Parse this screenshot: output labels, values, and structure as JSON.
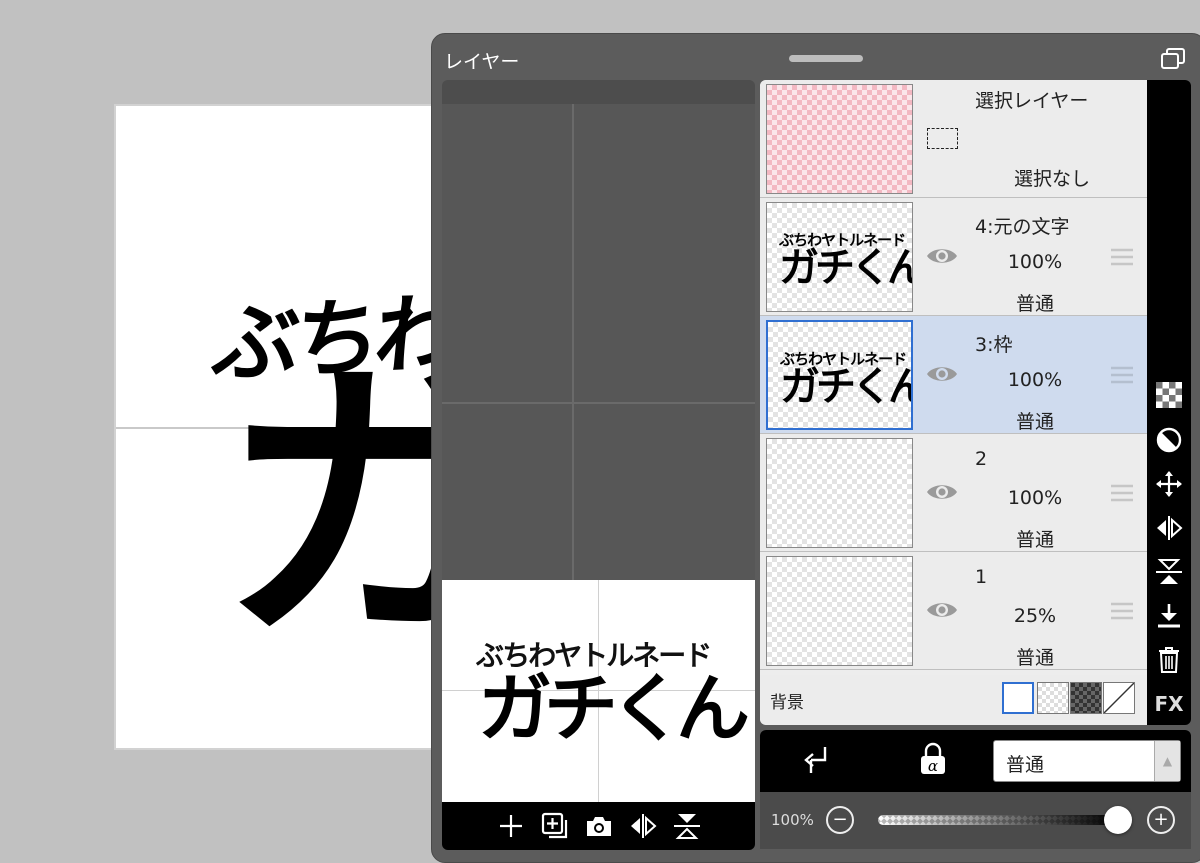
{
  "canvas": {
    "artwork_subtitle": "ぶちわヤトルネード",
    "artwork_title": "ガチくん"
  },
  "panel": {
    "title": "レイヤー"
  },
  "preview": {
    "subtitle": "ぶちわヤトルネード",
    "title": "ガチくん",
    "toolbar": [
      "add-layer",
      "add-copy-layer",
      "camera",
      "flip-horizontal",
      "flip-vertical"
    ]
  },
  "selection_layer": {
    "name": "選択レイヤー",
    "status": "選択なし"
  },
  "layers": [
    {
      "name": "4:元の文字",
      "opacity": "100%",
      "mode": "普通",
      "selected": false,
      "has_art": true
    },
    {
      "name": "3:枠",
      "opacity": "100%",
      "mode": "普通",
      "selected": true,
      "has_art": true
    },
    {
      "name": "2",
      "opacity": "100%",
      "mode": "普通",
      "selected": false,
      "has_art": false
    },
    {
      "name": "1",
      "opacity": "25%",
      "mode": "普通",
      "selected": false,
      "has_art": false
    }
  ],
  "thumb_art": {
    "subtitle": "ぶちわヤトルネード",
    "title": "ガチくん"
  },
  "background": {
    "label": "背景",
    "swatches": [
      "white",
      "transparent-light",
      "transparent-dark",
      "none"
    ]
  },
  "side_tools": [
    "checker-icon",
    "half-circle-icon",
    "move-icon",
    "flip-h-icon",
    "flip-v-icon",
    "merge-down-icon",
    "trash-icon",
    "FX",
    "more-icon"
  ],
  "blend": {
    "value": "普通"
  },
  "opacity": {
    "label": "100%",
    "value": 100
  },
  "colors": {
    "accent": "#2f6fd1",
    "selected_row": "#cfdbee",
    "panel": "#5c5c5c"
  }
}
